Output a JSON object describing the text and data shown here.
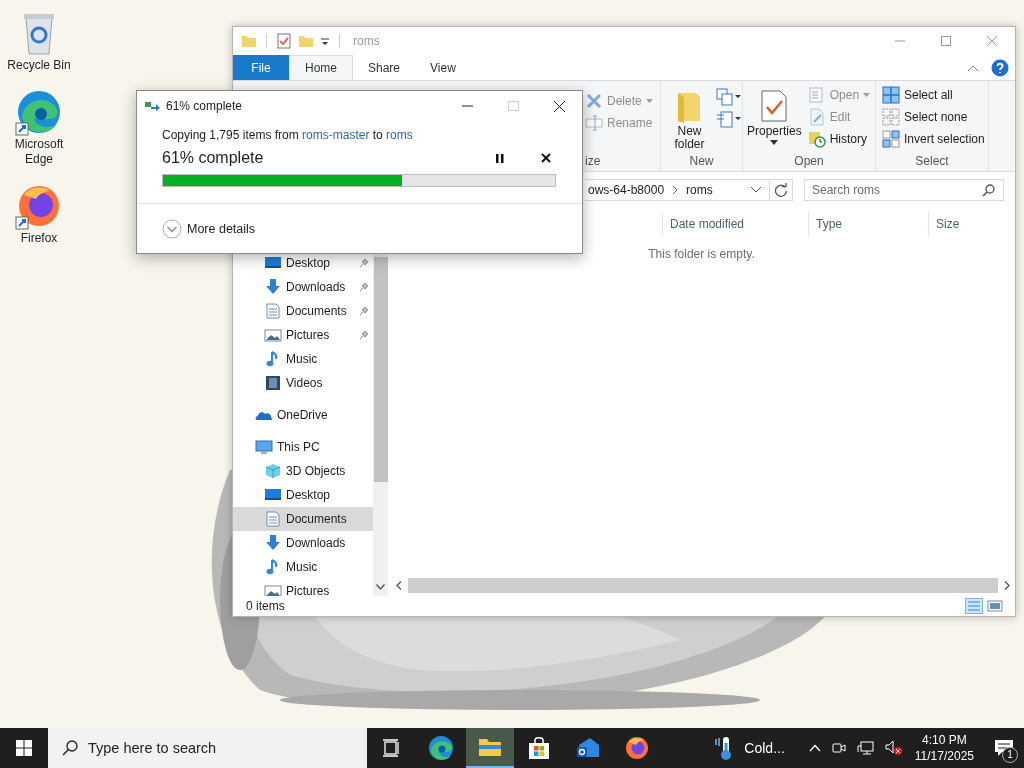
{
  "desktop": {
    "icons": [
      {
        "kind": "recycle",
        "label": "Recycle Bin"
      },
      {
        "kind": "edge",
        "label": "Microsoft Edge"
      },
      {
        "kind": "firefox",
        "label": "Firefox"
      }
    ]
  },
  "explorer": {
    "title": "roms",
    "tabs": [
      {
        "label": "File",
        "kind": "file",
        "selected": false
      },
      {
        "label": "Home",
        "kind": "tab",
        "selected": true
      },
      {
        "label": "Share",
        "kind": "tab",
        "selected": false
      },
      {
        "label": "View",
        "kind": "tab",
        "selected": false
      }
    ],
    "ribbon": {
      "groups": [
        {
          "kind": "organize",
          "label": "ize",
          "items": [
            {
              "kind": "delete",
              "label": "Delete",
              "dropdown": true,
              "disabled": true
            },
            {
              "kind": "rename",
              "label": "Rename",
              "dropdown": false,
              "disabled": true
            }
          ]
        },
        {
          "kind": "new",
          "label": "New",
          "big": {
            "kind": "newfolder",
            "label": "New folder",
            "dropdown": false
          }
        },
        {
          "kind": "open",
          "label": "Open",
          "big": {
            "kind": "properties",
            "label": "Properties",
            "dropdown": true
          },
          "items": [
            {
              "kind": "open",
              "label": "Open",
              "dropdown": true,
              "disabled": true
            },
            {
              "kind": "edit",
              "label": "Edit",
              "dropdown": false,
              "disabled": true
            },
            {
              "kind": "history",
              "label": "History",
              "dropdown": false,
              "disabled": false
            }
          ]
        },
        {
          "kind": "select",
          "label": "Select",
          "items": [
            {
              "kind": "selectall",
              "label": "Select all",
              "dropdown": false,
              "disabled": false
            },
            {
              "kind": "selectnone",
              "label": "Select none",
              "dropdown": false,
              "disabled": false
            },
            {
              "kind": "invert",
              "label": "Invert selection",
              "dropdown": false,
              "disabled": false
            }
          ]
        }
      ]
    },
    "address": [
      "ows-64-b8000",
      "roms"
    ],
    "search": {
      "placeholder": "Search roms"
    },
    "nav": {
      "pinned_items": [
        {
          "kind": "desktop",
          "label": "Desktop",
          "pinned": true,
          "selected": false
        },
        {
          "kind": "downloads",
          "label": "Downloads",
          "pinned": true,
          "selected": false
        },
        {
          "kind": "documents",
          "label": "Documents",
          "pinned": true,
          "selected": false
        },
        {
          "kind": "pictures",
          "label": "Pictures",
          "pinned": true,
          "selected": false
        },
        {
          "kind": "music",
          "label": "Music",
          "pinned": false,
          "selected": false
        },
        {
          "kind": "videos",
          "label": "Videos",
          "pinned": false,
          "selected": false
        }
      ],
      "items": [
        {
          "kind": "onedrive",
          "label": "OneDrive",
          "selected": false
        },
        {
          "kind": "pc",
          "label": "This PC",
          "selected": false,
          "children": [
            {
              "kind": "objects3d",
              "label": "3D Objects",
              "selected": false
            },
            {
              "kind": "desktop",
              "label": "Desktop",
              "selected": false
            },
            {
              "kind": "documents",
              "label": "Documents",
              "selected": true
            },
            {
              "kind": "downloads",
              "label": "Downloads",
              "selected": false
            },
            {
              "kind": "music",
              "label": "Music",
              "selected": false
            },
            {
              "kind": "pictures",
              "label": "Pictures",
              "selected": false
            }
          ]
        }
      ]
    },
    "columns": [
      "Date modified",
      "Type",
      "Size"
    ],
    "empty_message": "This folder is empty.",
    "status": "0 items"
  },
  "dialog": {
    "title": "61% complete",
    "message": [
      {
        "kind": "text",
        "text": "Copying 1,795 items from "
      },
      {
        "kind": "link",
        "text": "roms-master"
      },
      {
        "kind": "text",
        "text": " to "
      },
      {
        "kind": "link",
        "text": "roms"
      }
    ],
    "progress_text": "61% complete",
    "level": 0.61,
    "details": "More details"
  },
  "taskbar": {
    "search": {
      "placeholder": "Type here to search"
    },
    "apps": [
      {
        "kind": "taskview",
        "active": false
      },
      {
        "kind": "edge",
        "active": false
      },
      {
        "kind": "explorer",
        "active": true
      },
      {
        "kind": "store",
        "active": false
      },
      {
        "kind": "mail",
        "active": false
      },
      {
        "kind": "firefox",
        "active": false
      }
    ],
    "weather": "Cold...",
    "time": "4:10 PM",
    "date": "11/17/2025",
    "notifications": "1"
  }
}
